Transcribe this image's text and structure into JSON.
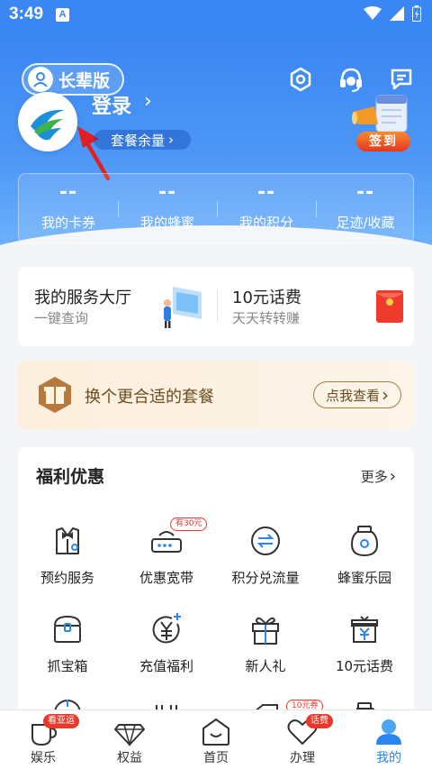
{
  "status_bar": {
    "time": "3:49",
    "notif_letter": "A"
  },
  "header": {
    "elder_mode_label": "长辈版",
    "login_text": "登录",
    "login_chevron": "›",
    "package_balance": "套餐余量",
    "package_chevron": "›",
    "checkin_label": "签到",
    "colors": {
      "header_blue": "#3a86f2",
      "checkin_red": "#e2361f",
      "pointer_arrow": "#e02020"
    }
  },
  "stats": [
    {
      "value": "--",
      "label": "我的卡券"
    },
    {
      "value": "--",
      "label": "我的蜂蜜"
    },
    {
      "value": "--",
      "label": "我的积分"
    },
    {
      "value": "--",
      "label": "足迹/收藏"
    }
  ],
  "service_card": {
    "left": {
      "title": "我的服务大厅",
      "subtitle": "一键查询"
    },
    "right": {
      "title": "10元话费",
      "subtitle": "天天转转赚"
    }
  },
  "plan_banner": {
    "text": "换个更合适的套餐",
    "button": "点我查看",
    "button_chevron": "›"
  },
  "benefits": {
    "title": "福利优惠",
    "more": "更多",
    "more_chevron": "›",
    "items": [
      {
        "label": "预约服务",
        "icon": "suit-bowtie-icon"
      },
      {
        "label": "优惠宽带",
        "icon": "router-icon",
        "badge": "有30元"
      },
      {
        "label": "积分兑流量",
        "icon": "exchange-icon"
      },
      {
        "label": "蜂蜜乐园",
        "icon": "honey-jar-icon"
      },
      {
        "label": "抓宝箱",
        "icon": "treasure-chest-icon"
      },
      {
        "label": "充值福利",
        "icon": "yuan-coin-icon"
      },
      {
        "label": "新人礼",
        "icon": "gift-box-icon"
      },
      {
        "label": "10元话费",
        "icon": "yuan-gift-icon"
      }
    ],
    "partial_row_badge": "10元券"
  },
  "bottom_nav": [
    {
      "label": "娱乐",
      "icon": "coffee-cup-icon",
      "badge": "看亚运"
    },
    {
      "label": "权益",
      "icon": "diamond-icon"
    },
    {
      "label": "首页",
      "icon": "home-icon"
    },
    {
      "label": "办理",
      "icon": "heart-icon",
      "badge": "话费"
    },
    {
      "label": "我的",
      "icon": "user-icon",
      "active": true
    }
  ]
}
